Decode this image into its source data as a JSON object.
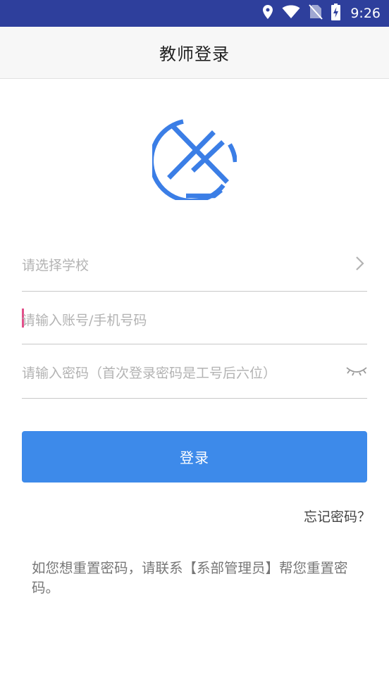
{
  "status_bar": {
    "time": "9:26",
    "icons": [
      "location-icon",
      "wifi-icon",
      "no-sim-icon",
      "battery-charging-icon"
    ],
    "background": "#2e3f9c"
  },
  "toolbar": {
    "title": "教师登录"
  },
  "logo": {
    "icon": "app-logo-icon",
    "color": "#3b7ee6"
  },
  "form": {
    "school_placeholder": "请选择学校",
    "account_placeholder": "请输入账号/手机号码",
    "password_placeholder": "请输入密码（首次登录密码是工号后六位）"
  },
  "login_button": {
    "label": "登录",
    "color": "#3d8aea"
  },
  "forgot_password": "忘记密码？",
  "notice": "如您想重置密码，请联系【系部管理员】帮您重置密码。"
}
